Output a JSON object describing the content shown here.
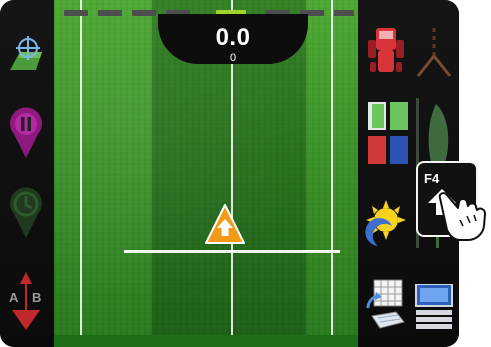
{
  "readout": {
    "value": "0.0",
    "sub_value": "0"
  },
  "function_key": {
    "label": "F4",
    "icon": "home-arrow-icon"
  },
  "left_panel": {
    "items": [
      {
        "name": "field-map-icon"
      },
      {
        "name": "pause-pin-icon"
      },
      {
        "name": "history-pin-icon"
      },
      {
        "name": "ab-line-icon",
        "label": "A",
        "label_b": "B"
      }
    ]
  },
  "right_panel": {
    "items": [
      {
        "name": "tractor-icon"
      },
      {
        "name": "branch-icon"
      },
      {
        "name": "section-control-icon"
      },
      {
        "name": "field-boundary-icon"
      },
      {
        "name": "day-night-icon"
      },
      {
        "name": "settings-grid-icon"
      },
      {
        "name": "display-icon"
      }
    ]
  },
  "colors": {
    "field_green": "#3d9228",
    "cursor_orange": "#f29a17",
    "active_indicator": "#9fd42e",
    "pause_purple": "#8e1a7f",
    "ab_red": "#c0282c"
  }
}
